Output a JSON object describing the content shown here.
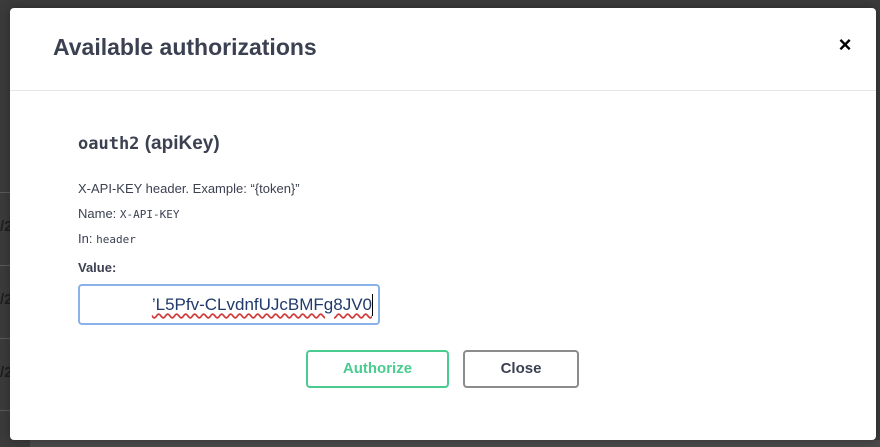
{
  "modal": {
    "title": "Available authorizations",
    "close_icon": "close-icon",
    "close_glyph": "×"
  },
  "scheme": {
    "name": "oauth2",
    "type": "(apiKey)",
    "description": "X-API-KEY header. Example: “{token}”",
    "name_label": "Name:",
    "name_value": "X-API-KEY",
    "in_label": "In:",
    "in_value": "header",
    "value_label": "Value:",
    "value_input": "’L5Pfv-CLvdnfUJcBMFg8JV0"
  },
  "buttons": {
    "authorize": "Authorize",
    "close": "Close"
  },
  "background": {
    "fragments": [
      "/2",
      "/2",
      "/2"
    ]
  },
  "colors": {
    "authorize_accent": "#49cc90",
    "input_focus_border": "#8ab2e8",
    "title_text": "#3b4151"
  }
}
